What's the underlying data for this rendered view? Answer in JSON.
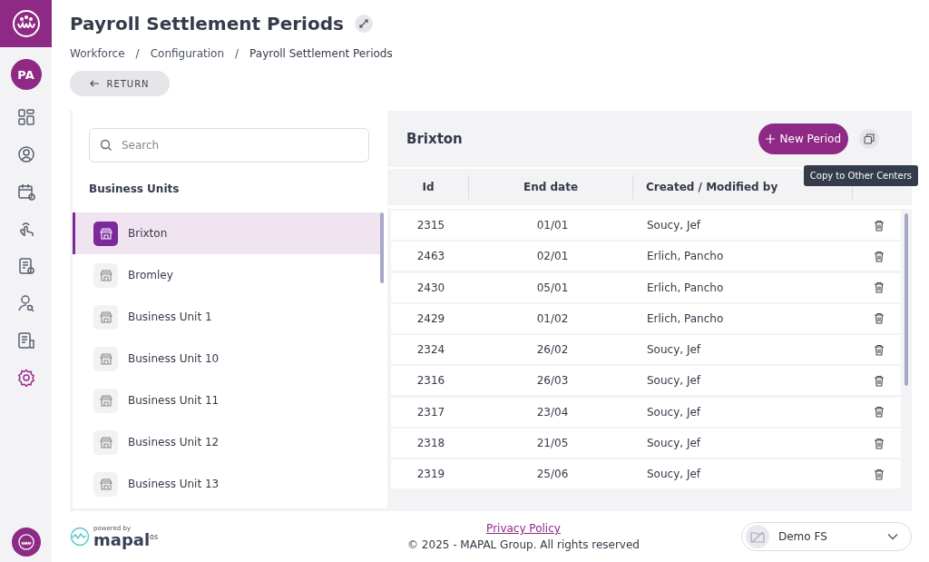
{
  "sidebar": {
    "avatar": "PA",
    "items": [
      {
        "kind": "dashboard",
        "selected": false
      },
      {
        "kind": "user",
        "selected": false
      },
      {
        "kind": "calendar",
        "selected": false
      },
      {
        "kind": "hand",
        "selected": false
      },
      {
        "kind": "document",
        "selected": false
      },
      {
        "kind": "user-search",
        "selected": false
      },
      {
        "kind": "report",
        "selected": false
      },
      {
        "kind": "settings",
        "selected": true
      }
    ]
  },
  "page": {
    "title": "Payroll Settlement Periods",
    "breadcrumb": [
      "Workforce",
      "Configuration",
      "Payroll Settlement Periods"
    ],
    "breadcrumb_separator": "/",
    "return_button": "RETURN"
  },
  "units_panel": {
    "search": {
      "placeholder": "Search"
    },
    "heading": "Business Units",
    "items": [
      {
        "label": "Brixton",
        "selected": true
      },
      {
        "label": "Bromley",
        "selected": false
      },
      {
        "label": "Business Unit 1",
        "selected": false
      },
      {
        "label": "Business Unit 10",
        "selected": false
      },
      {
        "label": "Business Unit 11",
        "selected": false
      },
      {
        "label": "Business Unit 12",
        "selected": false
      },
      {
        "label": "Business Unit 13",
        "selected": false
      }
    ]
  },
  "periods_panel": {
    "title": "Brixton",
    "new_button": "New Period",
    "tooltip": "Copy to Other Centers",
    "columns": [
      "Id",
      "End date",
      "Created / Modified by"
    ],
    "rows": [
      [
        "2315",
        "01/01",
        "Soucy, Jef"
      ],
      [
        "2463",
        "02/01",
        "Erlich, Pancho"
      ],
      [
        "2430",
        "05/01",
        "Erlich, Pancho"
      ],
      [
        "2429",
        "01/02",
        "Erlich, Pancho"
      ],
      [
        "2324",
        "26/02",
        "Soucy, Jef"
      ],
      [
        "2316",
        "26/03",
        "Soucy, Jef"
      ],
      [
        "2317",
        "23/04",
        "Soucy, Jef"
      ],
      [
        "2318",
        "21/05",
        "Soucy, Jef"
      ],
      [
        "2319",
        "25/06",
        "Soucy, Jef"
      ]
    ]
  },
  "footer": {
    "powered_by": "powered by",
    "brand": "mapal",
    "brand_suffix": "os",
    "privacy_link": "Privacy Policy",
    "copyright": "© 2025 - MAPAL Group. All rights reserved",
    "account": "Demo FS"
  }
}
